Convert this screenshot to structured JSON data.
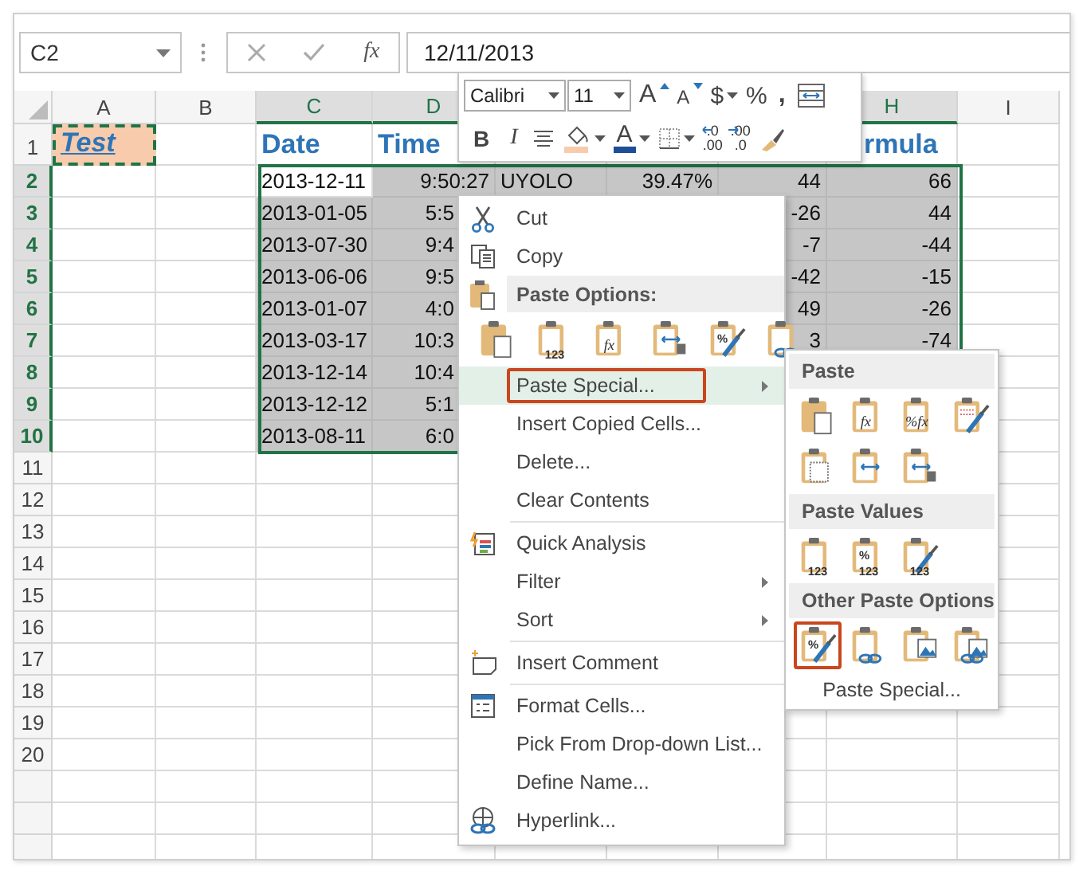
{
  "formula_bar": {
    "name_box": "C2",
    "function_label": "fx",
    "value": "12/11/2013"
  },
  "columns": [
    {
      "label": "A",
      "selected": false
    },
    {
      "label": "B",
      "selected": false
    },
    {
      "label": "C",
      "selected": true
    },
    {
      "label": "D",
      "selected": true
    },
    {},
    {},
    {},
    {
      "label": "H",
      "selected": true
    },
    {
      "label": "I",
      "selected": false
    }
  ],
  "rows": [
    {
      "number": "1",
      "selected": false,
      "cells": {
        "a": {
          "text": "Test",
          "kind": "title"
        },
        "c": {
          "text": "Date",
          "kind": "heading"
        },
        "d": {
          "text": "Time",
          "kind": "heading"
        },
        "h": {
          "text": "rmula",
          "kind": "cutheading"
        }
      }
    },
    {
      "number": "2",
      "selected": true,
      "cells": {
        "c": {
          "text": "2013-12-11",
          "kind": "text",
          "selected": false
        },
        "d": {
          "text": "9:50:27",
          "kind": "number",
          "selected": true
        },
        "e": {
          "text": "UYOLO",
          "kind": "text",
          "selected": true
        },
        "f": {
          "text": "39.47%",
          "kind": "number",
          "selected": true
        },
        "g": {
          "text": "44",
          "kind": "number",
          "selected": true
        },
        "h": {
          "text": "66",
          "kind": "number",
          "selected": true
        }
      }
    },
    {
      "number": "3",
      "selected": true,
      "cells": {
        "c": {
          "text": "2013-01-05",
          "kind": "text",
          "selected": true
        },
        "d": {
          "text": "5:5",
          "kind": "cutnumber",
          "selected": true
        },
        "g": {
          "text": "-26",
          "kind": "number",
          "selected": true
        },
        "h": {
          "text": "44",
          "kind": "number",
          "selected": true
        }
      }
    },
    {
      "number": "4",
      "selected": true,
      "cells": {
        "c": {
          "text": "2013-07-30",
          "kind": "text",
          "selected": true
        },
        "d": {
          "text": "9:4",
          "kind": "cutnumber",
          "selected": true
        },
        "g": {
          "text": "-7",
          "kind": "number",
          "selected": true
        },
        "h": {
          "text": "-44",
          "kind": "number",
          "selected": true
        }
      }
    },
    {
      "number": "5",
      "selected": true,
      "cells": {
        "c": {
          "text": "2013-06-06",
          "kind": "text",
          "selected": true
        },
        "d": {
          "text": "9:5",
          "kind": "cutnumber",
          "selected": true
        },
        "g": {
          "text": "-42",
          "kind": "number",
          "selected": true
        },
        "h": {
          "text": "-15",
          "kind": "number",
          "selected": true
        }
      }
    },
    {
      "number": "6",
      "selected": true,
      "cells": {
        "c": {
          "text": "2013-01-07",
          "kind": "text",
          "selected": true
        },
        "d": {
          "text": "4:0",
          "kind": "cutnumber",
          "selected": true
        },
        "g": {
          "text": "49",
          "kind": "number",
          "selected": true
        },
        "h": {
          "text": "-26",
          "kind": "number",
          "selected": true
        }
      }
    },
    {
      "number": "7",
      "selected": true,
      "cells": {
        "c": {
          "text": "2013-03-17",
          "kind": "text",
          "selected": true
        },
        "d": {
          "text": "10:3",
          "kind": "cutnumber",
          "selected": true
        },
        "g": {
          "text": "3",
          "kind": "number",
          "selected": true
        },
        "h": {
          "text": "-74",
          "kind": "number",
          "selected": true
        }
      }
    },
    {
      "number": "8",
      "selected": true,
      "cells": {
        "c": {
          "text": "2013-12-14",
          "kind": "text",
          "selected": true
        },
        "d": {
          "text": "10:4",
          "kind": "cutnumber",
          "selected": true
        }
      }
    },
    {
      "number": "9",
      "selected": true,
      "cells": {
        "c": {
          "text": "2013-12-12",
          "kind": "text",
          "selected": true
        },
        "d": {
          "text": "5:1",
          "kind": "cutnumber",
          "selected": true
        }
      }
    },
    {
      "number": "10",
      "selected": true,
      "cells": {
        "c": {
          "text": "2013-08-11",
          "kind": "text",
          "selected": true
        },
        "d": {
          "text": "6:0",
          "kind": "cutnumber",
          "selected": true
        }
      }
    },
    {
      "number": "11",
      "selected": false
    },
    {
      "number": "12",
      "selected": false
    },
    {
      "number": "13",
      "selected": false
    },
    {
      "number": "14",
      "selected": false
    },
    {
      "number": "15",
      "selected": false
    },
    {
      "number": "16",
      "selected": false
    },
    {
      "number": "17",
      "selected": false
    },
    {
      "number": "18",
      "selected": false
    },
    {
      "number": "19",
      "selected": false
    },
    {
      "number": "20",
      "selected": false
    }
  ],
  "toolbar": {
    "font": "Calibri",
    "size": "11",
    "row1": [
      {
        "kind": "grow",
        "label": "A"
      },
      {
        "kind": "shrink",
        "label": "A"
      },
      {
        "kind": "currency",
        "label": "$"
      },
      {
        "kind": "percent",
        "label": "%"
      },
      {
        "kind": "comma",
        "label": ","
      },
      {
        "kind": "wrap"
      }
    ],
    "row2": [
      {
        "kind": "bold",
        "label": "B"
      },
      {
        "kind": "italic",
        "label": "I"
      },
      {
        "kind": "align"
      },
      {
        "kind": "fill"
      },
      {
        "kind": "font_color",
        "label": "A"
      },
      {
        "kind": "borders"
      },
      {
        "kind": "inc_decimal",
        "labels": [
          ".0",
          ".00"
        ]
      },
      {
        "kind": "dec_decimal",
        "labels": [
          ".00",
          ".0"
        ]
      },
      {
        "kind": "brush"
      }
    ]
  },
  "context_menu": [
    {
      "kind": "cut",
      "label": "Cut",
      "selected": false,
      "submenu": false
    },
    {
      "kind": "copy",
      "label": "Copy",
      "selected": false,
      "submenu": false
    },
    {
      "kind": "header",
      "label": "Paste Options:"
    },
    {
      "kind": "icons",
      "icons": [
        {
          "kind": "paste"
        },
        {
          "kind": "values",
          "labels": [
            "123"
          ]
        },
        {
          "kind": "formulas",
          "labels": [
            "fx"
          ]
        },
        {
          "kind": "transpose"
        },
        {
          "kind": "formatting",
          "labels": [
            "%"
          ]
        },
        {
          "kind": "link"
        }
      ]
    },
    {
      "kind": "plain",
      "label": "Paste Special...",
      "selected": true,
      "submenu": true
    },
    {
      "kind": "plain",
      "label": "Insert Copied Cells...",
      "selected": false,
      "submenu": false
    },
    {
      "kind": "plain",
      "label": "Delete...",
      "selected": false,
      "submenu": false
    },
    {
      "kind": "plain",
      "label": "Clear Contents",
      "selected": false,
      "submenu": false
    },
    {
      "kind": "separator"
    },
    {
      "kind": "analysis",
      "label": "Quick Analysis",
      "selected": false,
      "submenu": false
    },
    {
      "kind": "plain",
      "label": "Filter",
      "selected": false,
      "submenu": true
    },
    {
      "kind": "plain",
      "label": "Sort",
      "selected": false,
      "submenu": true
    },
    {
      "kind": "separator"
    },
    {
      "kind": "comment",
      "label": "Insert Comment",
      "selected": false,
      "submenu": false
    },
    {
      "kind": "separator"
    },
    {
      "kind": "format",
      "label": "Format Cells...",
      "selected": false,
      "submenu": false
    },
    {
      "kind": "plain",
      "label": "Pick From Drop-down List...",
      "selected": false,
      "submenu": false
    },
    {
      "kind": "plain",
      "label": "Define Name...",
      "selected": false,
      "submenu": false
    },
    {
      "kind": "hyperlink",
      "label": "Hyperlink...",
      "selected": false,
      "submenu": false
    }
  ],
  "paste_submenu": {
    "sections": [
      {
        "title": "Paste",
        "icons": [
          {
            "kind": "paste",
            "selected": false
          },
          {
            "kind": "formulas",
            "labels": [
              "fx"
            ],
            "selected": false
          },
          {
            "kind": "number_formulas",
            "labels": [
              "%fx"
            ],
            "selected": false
          },
          {
            "kind": "source_formatting",
            "selected": false
          },
          {
            "kind": "no_borders",
            "selected": false
          },
          {
            "kind": "widths",
            "selected": false
          },
          {
            "kind": "transpose",
            "selected": false
          }
        ]
      },
      {
        "title": "Paste Values",
        "icons": [
          {
            "kind": "values",
            "labels": [
              "123"
            ],
            "selected": false
          },
          {
            "kind": "values_number",
            "labels": [
              "%",
              "123"
            ],
            "selected": false
          },
          {
            "kind": "values_format",
            "labels": [
              "123"
            ],
            "selected": false
          }
        ]
      },
      {
        "title": "Other Paste Options",
        "icons": [
          {
            "kind": "formatting",
            "labels": [
              "%"
            ],
            "selected": true
          },
          {
            "kind": "link",
            "selected": false
          },
          {
            "kind": "picture",
            "selected": false
          },
          {
            "kind": "linked_picture",
            "selected": false
          }
        ]
      }
    ],
    "footer": "Paste Special..."
  }
}
